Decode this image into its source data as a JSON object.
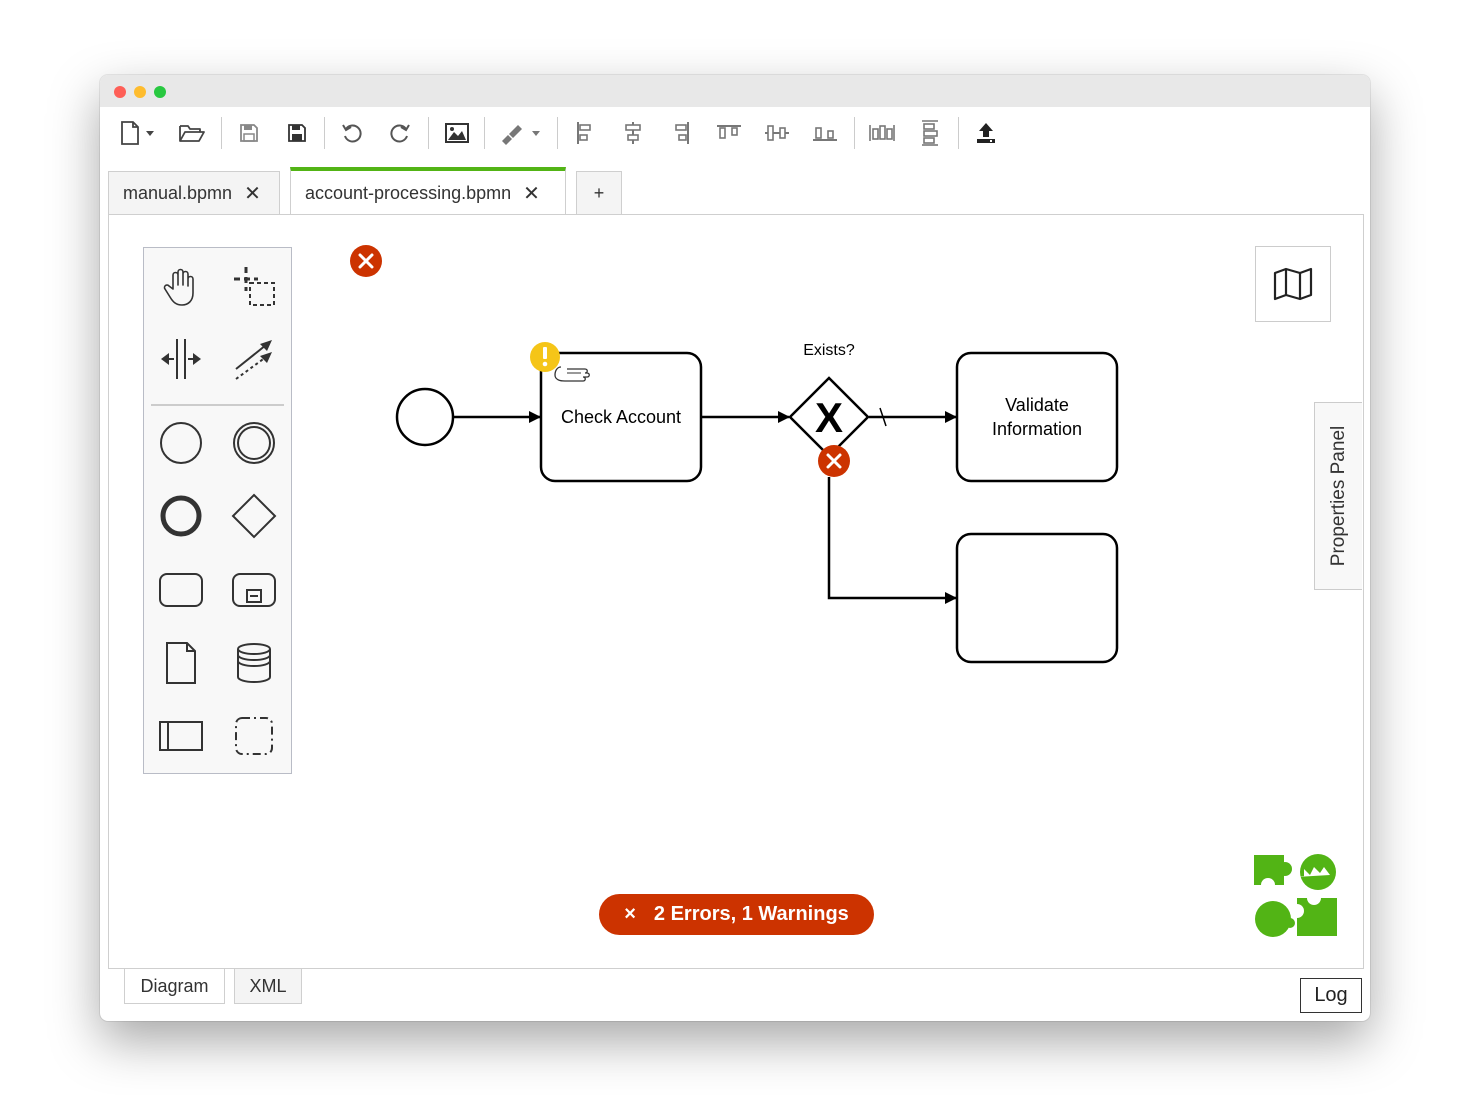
{
  "window": {
    "traffic_lights": [
      "close",
      "minimize",
      "zoom"
    ]
  },
  "toolbar": {
    "icons": [
      "new-file-icon",
      "open-folder-icon",
      "save-icon",
      "save-as-icon",
      "undo-icon",
      "redo-icon",
      "export-image-icon",
      "color-brush-icon",
      "align-left-icon",
      "align-center-icon",
      "align-right-icon",
      "align-top-icon",
      "align-middle-icon",
      "align-bottom-icon",
      "distribute-horizontal-icon",
      "distribute-vertical-icon",
      "deploy-icon"
    ]
  },
  "tabs": [
    {
      "label": "manual.bpmn",
      "active": false
    },
    {
      "label": "account-processing.bpmn",
      "active": true
    },
    {
      "label": "+",
      "active": false
    }
  ],
  "palette": {
    "tools": [
      "hand-tool-icon",
      "lasso-tool-icon",
      "space-tool-icon",
      "connect-tool-icon",
      "start-event-icon",
      "intermediate-event-icon",
      "end-event-icon",
      "gateway-icon",
      "task-icon",
      "subprocess-icon",
      "data-object-icon",
      "data-store-icon",
      "pool-icon",
      "group-icon"
    ]
  },
  "diagram": {
    "task1_label": "Check Account",
    "gateway_label": "Exists?",
    "task2_label_line1": "Validate",
    "task2_label_line2": "Information",
    "gateway_symbol": "X"
  },
  "properties_panel": {
    "label": "Properties Panel"
  },
  "lint": {
    "summary": "2 Errors, 1 Warnings",
    "icon": "×"
  },
  "bottom_tabs": [
    {
      "label": "Diagram",
      "active": true
    },
    {
      "label": "XML",
      "active": false
    }
  ],
  "log_button": "Log",
  "colors": {
    "accent": "#52b415",
    "error": "#cc3300",
    "warning": "#f5c518",
    "logo": "#52b415"
  }
}
